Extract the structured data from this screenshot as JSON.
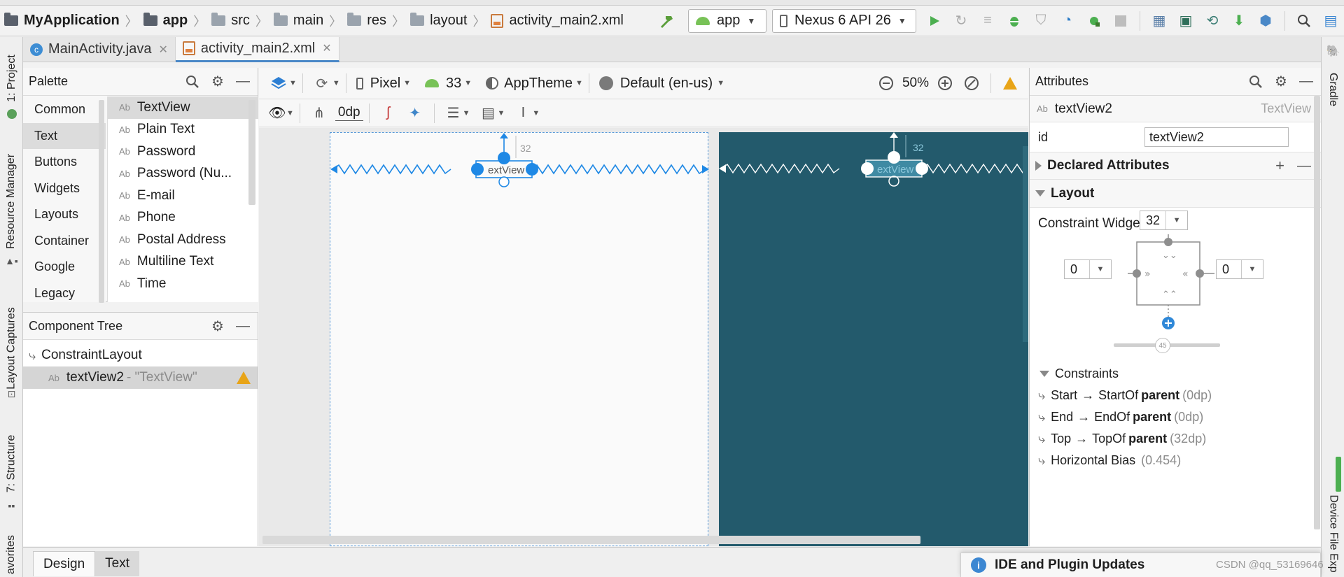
{
  "navbar": {
    "breadcrumbs": [
      "MyApplication",
      "app",
      "src",
      "main",
      "res",
      "layout",
      "activity_main2.xml"
    ],
    "run_config": "app",
    "device": "Nexus 6 API 26"
  },
  "editor_tabs": [
    {
      "label": "MainActivity.java"
    },
    {
      "label": "activity_main2.xml"
    }
  ],
  "left_stripe": [
    "1: Project",
    "Resource Manager",
    "Layout Captures",
    "7: Structure",
    "avorites"
  ],
  "right_stripe": [
    "Gradle",
    "Device File Exp"
  ],
  "palette": {
    "title": "Palette",
    "categories": [
      "Common",
      "Text",
      "Buttons",
      "Widgets",
      "Layouts",
      "Container",
      "Google",
      "Legacy"
    ],
    "selected_category": "Text",
    "items": [
      {
        "abbr": "Ab",
        "label": "TextView"
      },
      {
        "abbr": "Ab",
        "label": "Plain Text"
      },
      {
        "abbr": "Ab",
        "label": "Password"
      },
      {
        "abbr": "Ab",
        "label": "Password (Nu..."
      },
      {
        "abbr": "Ab",
        "label": "E-mail"
      },
      {
        "abbr": "Ab",
        "label": "Phone"
      },
      {
        "abbr": "Ab",
        "label": "Postal Address"
      },
      {
        "abbr": "Ab",
        "label": "Multiline Text"
      },
      {
        "abbr": "Ab",
        "label": "Time"
      }
    ]
  },
  "component_tree": {
    "title": "Component Tree",
    "root": "ConstraintLayout",
    "child_abbr": "Ab",
    "child_name": "textView2",
    "child_detail": "- \"TextView\""
  },
  "design_toolbar": {
    "device": "Pixel",
    "api": "33",
    "theme": "AppTheme",
    "locale": "Default (en-us)",
    "zoom": "50%",
    "margin": "0dp"
  },
  "canvas": {
    "widget_text": "extView",
    "top_margin_label": "32"
  },
  "attributes": {
    "title": "Attributes",
    "component_id": "textView2",
    "component_type": "TextView",
    "id_label": "id",
    "id_value": "textView2",
    "declared_section": "Declared Attributes",
    "layout_section": "Layout",
    "constraint_widget_label": "Constraint Widget",
    "margin_top": "32",
    "margin_left": "0",
    "margin_right": "0",
    "bias": "45",
    "constraints_title": "Constraints",
    "constraints": [
      {
        "side": "Start",
        "target": "StartOf",
        "parent": "parent",
        "value": "(0dp)"
      },
      {
        "side": "End",
        "target": "EndOf",
        "parent": "parent",
        "value": "(0dp)"
      },
      {
        "side": "Top",
        "target": "TopOf",
        "parent": "parent",
        "value": "(32dp)"
      }
    ],
    "horizontal_bias_label": "Horizontal Bias",
    "horizontal_bias_value": "(0.454)"
  },
  "bottom": {
    "tabs": [
      "Design",
      "Text"
    ],
    "notification": "IDE and Plugin Updates",
    "watermark": "CSDN @qq_53169646"
  },
  "colors": {
    "accent_blue": "#1e88e5",
    "blueprint": "#235a6c",
    "run_green": "#4caf50",
    "warning": "#e8a417"
  }
}
